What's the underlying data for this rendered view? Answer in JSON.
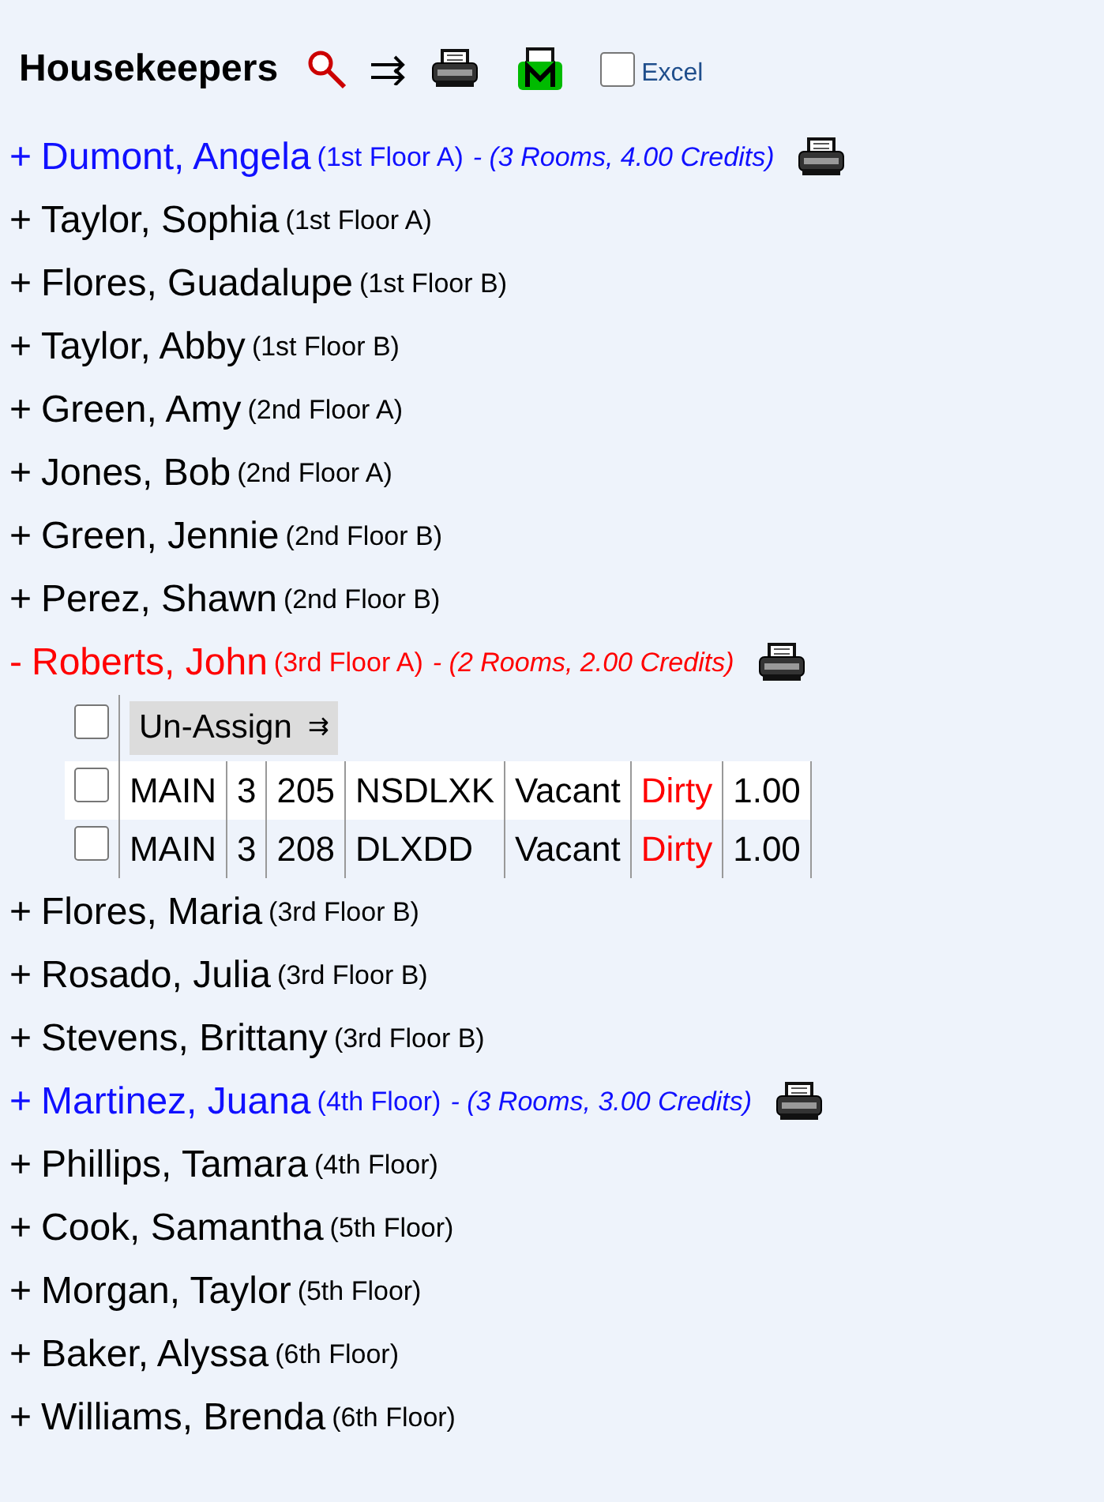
{
  "header": {
    "title": "Housekeepers",
    "excel": {
      "label": "Excel",
      "checked": false
    }
  },
  "housekeepers": [
    {
      "toggle": "+",
      "name": "Dumont, Angela",
      "area": "(1st Floor A)",
      "summary": "- (3 Rooms, 4.00 Credits)",
      "has_rooms": true,
      "expanded": false
    },
    {
      "toggle": "+",
      "name": "Taylor, Sophia",
      "area": "(1st Floor A)",
      "has_rooms": false,
      "expanded": false
    },
    {
      "toggle": "+",
      "name": "Flores, Guadalupe",
      "area": "(1st Floor B)",
      "has_rooms": false,
      "expanded": false
    },
    {
      "toggle": "+",
      "name": "Taylor, Abby",
      "area": "(1st Floor B)",
      "has_rooms": false,
      "expanded": false
    },
    {
      "toggle": "+",
      "name": "Green, Amy",
      "area": "(2nd Floor A)",
      "has_rooms": false,
      "expanded": false
    },
    {
      "toggle": "+",
      "name": "Jones, Bob",
      "area": "(2nd Floor A)",
      "has_rooms": false,
      "expanded": false
    },
    {
      "toggle": "+",
      "name": "Green, Jennie",
      "area": "(2nd Floor B)",
      "has_rooms": false,
      "expanded": false
    },
    {
      "toggle": "+",
      "name": "Perez, Shawn",
      "area": "(2nd Floor B)",
      "has_rooms": false,
      "expanded": false
    },
    {
      "toggle": "-",
      "name": "Roberts, John",
      "area": "(3rd Floor A)",
      "summary": "- (2 Rooms, 2.00 Credits)",
      "has_rooms": true,
      "expanded": true,
      "select_all": {
        "checked": false
      },
      "unassign_label": "Un-Assign",
      "unassign_icon": "⇉",
      "rooms": [
        {
          "checked": false,
          "cells": [
            "MAIN",
            "3",
            "205",
            "NSDLXK",
            "Vacant"
          ],
          "status": "Dirty",
          "color": "#ff0000",
          "credits": "1.00"
        },
        {
          "checked": false,
          "cells": [
            "MAIN",
            "3",
            "208",
            "DLXDD",
            "Vacant"
          ],
          "status": "Dirty",
          "color": "#ff0000",
          "credits": "1.00"
        }
      ]
    },
    {
      "toggle": "+",
      "name": "Flores, Maria",
      "area": "(3rd Floor B)",
      "has_rooms": false,
      "expanded": false
    },
    {
      "toggle": "+",
      "name": "Rosado, Julia",
      "area": "(3rd Floor B)",
      "has_rooms": false,
      "expanded": false
    },
    {
      "toggle": "+",
      "name": "Stevens, Brittany",
      "area": "(3rd Floor B)",
      "has_rooms": false,
      "expanded": false
    },
    {
      "toggle": "+",
      "name": "Martinez, Juana",
      "area": "(4th Floor)",
      "summary": "- (3 Rooms, 3.00 Credits)",
      "has_rooms": true,
      "expanded": false
    },
    {
      "toggle": "+",
      "name": "Phillips, Tamara",
      "area": "(4th Floor)",
      "has_rooms": false,
      "expanded": false
    },
    {
      "toggle": "+",
      "name": "Cook, Samantha",
      "area": "(5th Floor)",
      "has_rooms": false,
      "expanded": false
    },
    {
      "toggle": "+",
      "name": "Morgan, Taylor",
      "area": "(5th Floor)",
      "has_rooms": false,
      "expanded": false
    },
    {
      "toggle": "+",
      "name": "Baker, Alyssa",
      "area": "(6th Floor)",
      "has_rooms": false,
      "expanded": false
    },
    {
      "toggle": "+",
      "name": "Williams, Brenda",
      "area": "(6th Floor)",
      "has_rooms": false,
      "expanded": false
    }
  ]
}
